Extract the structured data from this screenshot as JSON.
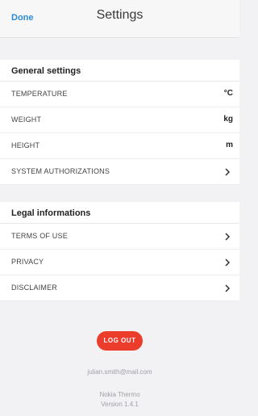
{
  "navbar": {
    "done_label": "Done",
    "title": "Settings"
  },
  "general": {
    "header": "General settings",
    "rows": [
      {
        "label": "TEMPERATURE",
        "value": "°C"
      },
      {
        "label": "WEIGHT",
        "value": "kg"
      },
      {
        "label": "HEIGHT",
        "value": "m"
      },
      {
        "label": "SYSTEM AUTHORIZATIONS",
        "icon": "chevron-right-icon"
      }
    ]
  },
  "legal": {
    "header": "Legal informations",
    "rows": [
      {
        "label": "TERMS OF USE",
        "icon": "chevron-right-icon"
      },
      {
        "label": "PRIVACY",
        "icon": "chevron-right-icon"
      },
      {
        "label": "DISCLAIMER",
        "icon": "chevron-right-icon"
      }
    ]
  },
  "footer": {
    "logout_label": "LOG OUT",
    "email": "julian.smith@mail.com",
    "app_name": "Nokia Thermo",
    "version": "Version 1.4.1"
  },
  "colors": {
    "accent": "#2a8bd8",
    "logout": "#ec3d2c"
  }
}
